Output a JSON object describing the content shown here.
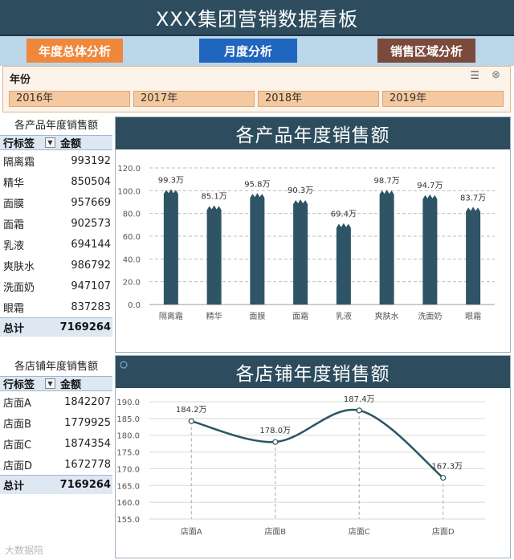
{
  "header": {
    "title": "XXX集团营销数据看板"
  },
  "nav": {
    "annual": "年度总体分析",
    "monthly": "月度分析",
    "region": "销售区域分析"
  },
  "slicer": {
    "title": "年份",
    "years": [
      "2016年",
      "2017年",
      "2018年",
      "2019年"
    ]
  },
  "product_table": {
    "title": "各产品年度销售额",
    "col_label": "行标签",
    "col_amount": "金额",
    "rows": [
      {
        "name": "隔离霜",
        "amount": "993192"
      },
      {
        "name": "精华",
        "amount": "850504"
      },
      {
        "name": "面膜",
        "amount": "957669"
      },
      {
        "name": "面霜",
        "amount": "902573"
      },
      {
        "name": "乳液",
        "amount": "694144"
      },
      {
        "name": "爽肤水",
        "amount": "986792"
      },
      {
        "name": "洗面奶",
        "amount": "947107"
      },
      {
        "name": "眼霜",
        "amount": "837283"
      }
    ],
    "total_label": "总计",
    "total": "7169264"
  },
  "store_table": {
    "title": "各店铺年度销售额",
    "col_label": "行标签",
    "col_amount": "金额",
    "rows": [
      {
        "name": "店面A",
        "amount": "1842207"
      },
      {
        "name": "店面B",
        "amount": "1779925"
      },
      {
        "name": "店面C",
        "amount": "1874354"
      },
      {
        "name": "店面D",
        "amount": "1672778"
      }
    ],
    "total_label": "总计",
    "total": "7169264"
  },
  "chart_data": [
    {
      "type": "bar",
      "title": "各产品年度销售额",
      "categories": [
        "隔离霜",
        "精华",
        "面膜",
        "面霜",
        "乳液",
        "爽肤水",
        "洗面奶",
        "眼霜"
      ],
      "values": [
        99.3,
        85.1,
        95.8,
        90.3,
        69.4,
        98.7,
        94.7,
        83.7
      ],
      "data_labels": [
        "99.3万",
        "85.1万",
        "95.8万",
        "90.3万",
        "69.4万",
        "98.7万",
        "94.7万",
        "83.7万"
      ],
      "ylim": [
        0,
        120
      ],
      "yticks": [
        "0.0",
        "20.0",
        "40.0",
        "60.0",
        "80.0",
        "100.0",
        "120.0"
      ],
      "grid": true,
      "color": "#2e5466"
    },
    {
      "type": "line",
      "title": "各店铺年度销售额",
      "categories": [
        "店面A",
        "店面B",
        "店面C",
        "店面D"
      ],
      "values": [
        184.2,
        178.0,
        187.4,
        167.3
      ],
      "data_labels": [
        "184.2万",
        "178.0万",
        "187.4万",
        "167.3万"
      ],
      "ylim": [
        155,
        190
      ],
      "yticks": [
        "155.0",
        "160.0",
        "165.0",
        "170.0",
        "175.0",
        "180.0",
        "185.0",
        "190.0"
      ],
      "grid": true,
      "color": "#2e5466"
    }
  ],
  "watermark": "大数据陪"
}
